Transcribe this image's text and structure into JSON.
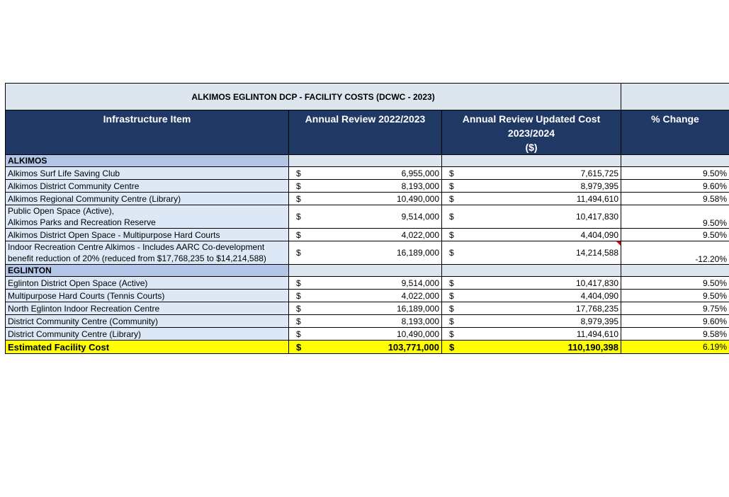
{
  "table": {
    "title": "ALKIMOS EGLINTON DCP - FACILITY COSTS (DCWC - 2023)",
    "headers": {
      "item": "Infrastructure Item",
      "review": "Annual Review 2022/2023",
      "updated_line1": "Annual Review Updated Cost",
      "updated_line2": "2023/2024",
      "updated_line3": "($)",
      "change": "% Change"
    },
    "currency_symbol": "$",
    "sections": [
      {
        "name": "ALKIMOS",
        "rows": [
          {
            "item": "Alkimos Surf Life Saving Club",
            "review": "6,955,000",
            "updated": "7,615,725",
            "change": "9.50%"
          },
          {
            "item": "Alkimos District Community Centre",
            "review": "8,193,000",
            "updated": "8,979,395",
            "change": "9.60%"
          },
          {
            "item": "Alkimos Regional Community Centre (Library)",
            "review": "10,490,000",
            "updated": "11,494,610",
            "change": "9.58%"
          },
          {
            "item_line1": "Public Open Space (Active),",
            "item_line2": "Alkimos Parks and Recreation Reserve",
            "review": "9,514,000",
            "updated": "10,417,830",
            "change": "9.50%"
          },
          {
            "item": "Alkimos District Open Space - Multipurpose Hard Courts",
            "review": "4,022,000",
            "updated": "4,404,090",
            "change": "9.50%"
          },
          {
            "item_line1": "Indoor Recreation Centre Alkimos - Includes AARC Co-development",
            "item_line2": "benefit reduction of 20% (reduced from $17,768,235 to $14,214,588)",
            "review": "16,189,000",
            "updated": "14,214,588",
            "change": "-12.20%"
          }
        ]
      },
      {
        "name": "EGLINTON",
        "rows": [
          {
            "item": "Eglinton District Open Space (Active)",
            "review": "9,514,000",
            "updated": "10,417,830",
            "change": "9.50%"
          },
          {
            "item": "Multipurpose Hard Courts (Tennis Courts)",
            "review": "4,022,000",
            "updated": "4,404,090",
            "change": "9.50%"
          },
          {
            "item": "North Eglinton Indoor Recreation Centre",
            "review": "16,189,000",
            "updated": "17,768,235",
            "change": "9.75%"
          },
          {
            "item": "District Community Centre (Community)",
            "review": "8,193,000",
            "updated": "8,979,395",
            "change": "9.60%"
          },
          {
            "item": "District Community Centre (Library)",
            "review": "10,490,000",
            "updated": "11,494,610",
            "change": "9.58%"
          }
        ]
      }
    ],
    "total": {
      "item": "Estimated Facility Cost",
      "review": "103,771,000",
      "updated": "110,190,398",
      "change": "6.19%"
    }
  },
  "colors": {
    "header_bg": "#1f3864",
    "title_bg": "#dde5ee",
    "section_bg": "#b4c6e7",
    "item_bg": "#dce8f5",
    "total_bg": "#ffff00",
    "comment_marker": "#e00000"
  }
}
